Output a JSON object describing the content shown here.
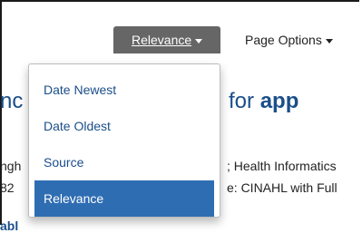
{
  "toolbar": {
    "sort_label": "Relevance",
    "page_options_label": "Page Options"
  },
  "sort_menu": {
    "items": [
      "Date Newest",
      "Date Oldest",
      "Source",
      "Relevance"
    ],
    "selected": "Relevance"
  },
  "background": {
    "title_left_fragment": "nc",
    "title_right_prefix": "for ",
    "title_right_strong": "app",
    "line1_left": "ngh",
    "line1_right": "; Health Informatics",
    "line2_left": "82",
    "line2_right": "e: CINAHL with Full",
    "available_fragment": "abl"
  },
  "colors": {
    "link_blue": "#1a4e8a",
    "selected_blue": "#2f6db3",
    "sort_button_bg": "#666666"
  }
}
